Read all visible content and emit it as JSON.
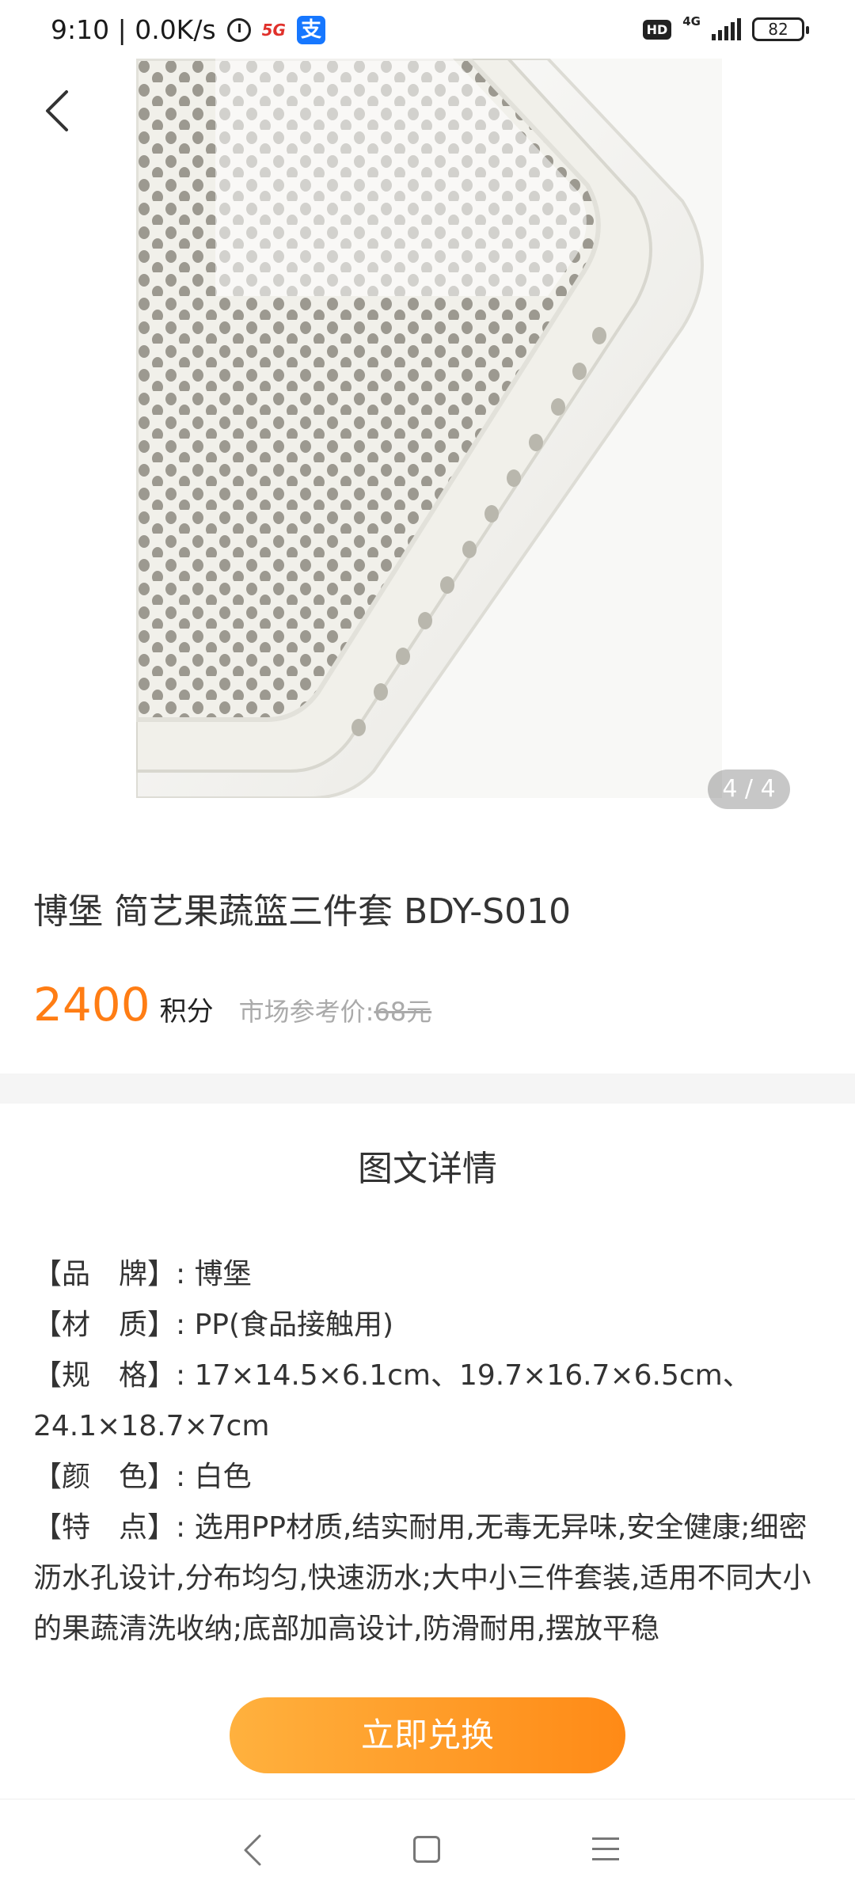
{
  "status_bar": {
    "time_speed": "9:10 | 0.0K/s",
    "net_5g": "5G",
    "alipay_glyph": "支",
    "hd": "HD",
    "signal": "4G",
    "battery": "82"
  },
  "gallery": {
    "indicator": "4 / 4"
  },
  "product": {
    "title": "博堡 简艺果蔬篮三件套 BDY-S010",
    "points": "2400",
    "points_unit": "积分",
    "market_label": "市场参考价:",
    "market_price": "68元"
  },
  "detail": {
    "heading": "图文详情",
    "specs": [
      "【品　牌】: 博堡",
      "【材　质】: PP(食品接触用)",
      "【规　格】: 17×14.5×6.1cm、19.7×16.7×6.5cm、24.1×18.7×7cm",
      "【颜　色】: 白色",
      "【特　点】: 选用PP材质,结实耐用,无毒无异味,安全健康;细密沥水孔设计,分布均匀,快速沥水;大中小三件套装,适用不同大小的果蔬清洗收纳;底部加高设计,防滑耐用,摆放平稳"
    ]
  },
  "cta": {
    "redeem_label": "立即兑换"
  },
  "colors": {
    "accent": "#ff7d14",
    "button_start": "#ffb13e",
    "button_end": "#ff8a16"
  }
}
